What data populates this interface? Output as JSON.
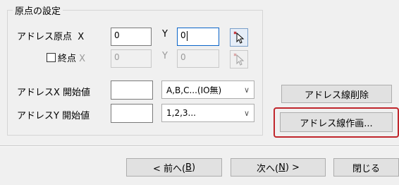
{
  "group": {
    "title": "原点の設定"
  },
  "address_origin": {
    "label": "アドレス原点",
    "x_label": "X",
    "x_value": "0",
    "y_label": "Y",
    "y_value": "0"
  },
  "end_point": {
    "label": "終点",
    "x_label": "X",
    "x_value": "0",
    "y_label": "Y",
    "y_value": "0",
    "checked": false
  },
  "address_x": {
    "label": "アドレスX 開始値",
    "value": "",
    "option": "A,B,C...(IO無)"
  },
  "address_y": {
    "label": "アドレスY 開始値",
    "value": "",
    "option": "1,2,3..."
  },
  "buttons": {
    "delete_lines": "アドレス線削除",
    "draw_lines": "アドレス線作画...",
    "prev_prefix": "< 前へ(",
    "prev_key": "B",
    "prev_suffix": ")",
    "next_prefix": "次へ(",
    "next_key": "N",
    "next_suffix": ") >",
    "close": "閉じる"
  },
  "colors": {
    "highlight": "#c0262c",
    "focus": "#0a64c8"
  }
}
